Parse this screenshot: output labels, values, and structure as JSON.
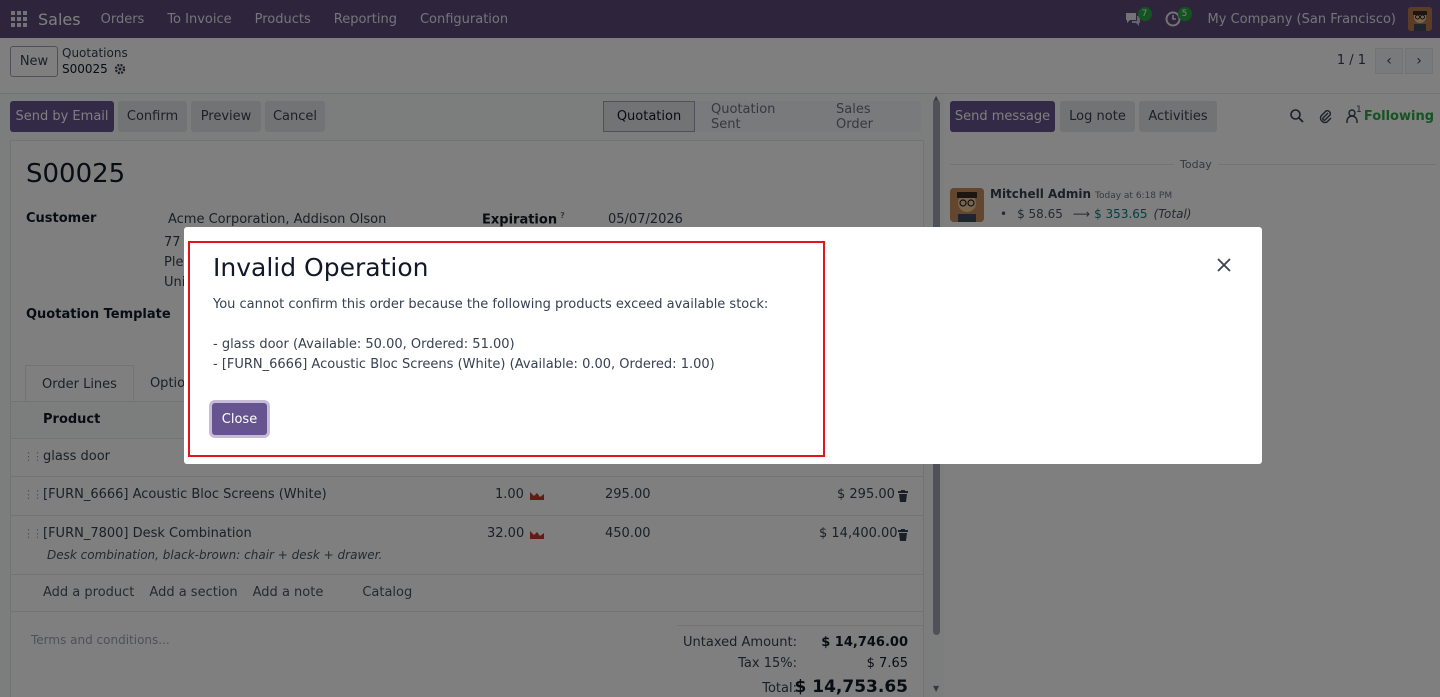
{
  "navbar": {
    "app_name": "Sales",
    "menu": [
      "Orders",
      "To Invoice",
      "Products",
      "Reporting",
      "Configuration"
    ],
    "messages_badge": "7",
    "activities_badge": "5",
    "company": "My Company (San Francisco)"
  },
  "control_panel": {
    "new_label": "New",
    "breadcrumb_parent": "Quotations",
    "breadcrumb_record": "S00025",
    "pager": "1 / 1"
  },
  "form_toolbar": {
    "send_email": "Send by Email",
    "confirm": "Confirm",
    "preview": "Preview",
    "cancel": "Cancel",
    "status_steps": [
      "Quotation",
      "Quotation Sent",
      "Sales Order"
    ],
    "active_status": "Quotation"
  },
  "form": {
    "record_name": "S00025",
    "customer_label": "Customer",
    "customer_name": "Acme Corporation, Addison Olson",
    "address_partial": [
      "77",
      "Ple",
      "Uni"
    ],
    "expiration_label": "Expiration",
    "expiration_help": "?",
    "expiration_value": "05/07/2026",
    "template_label": "Quotation Template",
    "tabs": [
      "Order Lines",
      "Option"
    ],
    "column_product": "Product",
    "lines": [
      {
        "product": "glass door",
        "qty": "",
        "price": "",
        "subtotal": "",
        "note": ""
      },
      {
        "product": "[FURN_6666] Acoustic Bloc Screens (White)",
        "qty": "1.00",
        "price": "295.00",
        "subtotal": "$ 295.00",
        "note": ""
      },
      {
        "product": "[FURN_7800] Desk Combination",
        "qty": "32.00",
        "price": "450.00",
        "subtotal": "$ 14,400.00",
        "note": "Desk combination, black-brown: chair + desk + drawer."
      }
    ],
    "add_links": [
      "Add a product",
      "Add a section",
      "Add a note",
      "Catalog"
    ],
    "terms_placeholder": "Terms and conditions...",
    "untaxed_label": "Untaxed Amount:",
    "untaxed_value": "$ 14,746.00",
    "tax_label": "Tax 15%:",
    "tax_value": "$ 7.65",
    "total_label": "Total:",
    "total_value": "$ 14,753.65"
  },
  "chatter": {
    "send_message": "Send message",
    "log_note": "Log note",
    "activities": "Activities",
    "followers_count": "1",
    "following": "Following",
    "today": "Today",
    "author": "Mitchell Admin",
    "time": "Today at 6:18 PM",
    "old_value": "$ 58.65",
    "new_value": "$ 353.65",
    "field": "(Total)"
  },
  "dialog": {
    "title": "Invalid Operation",
    "message": "You cannot confirm this order because the following products exceed available stock:",
    "item1": "- glass door (Available: 50.00, Ordered: 51.00)",
    "item2": "- [FURN_6666] Acoustic Bloc Screens (White) (Available: 0.00, Ordered: 1.00)",
    "close_label": "Close"
  },
  "colors": {
    "navbar": "#5c4a7a",
    "primary": "#65548f",
    "highlight": "#e5141b",
    "following": "#28a745"
  }
}
